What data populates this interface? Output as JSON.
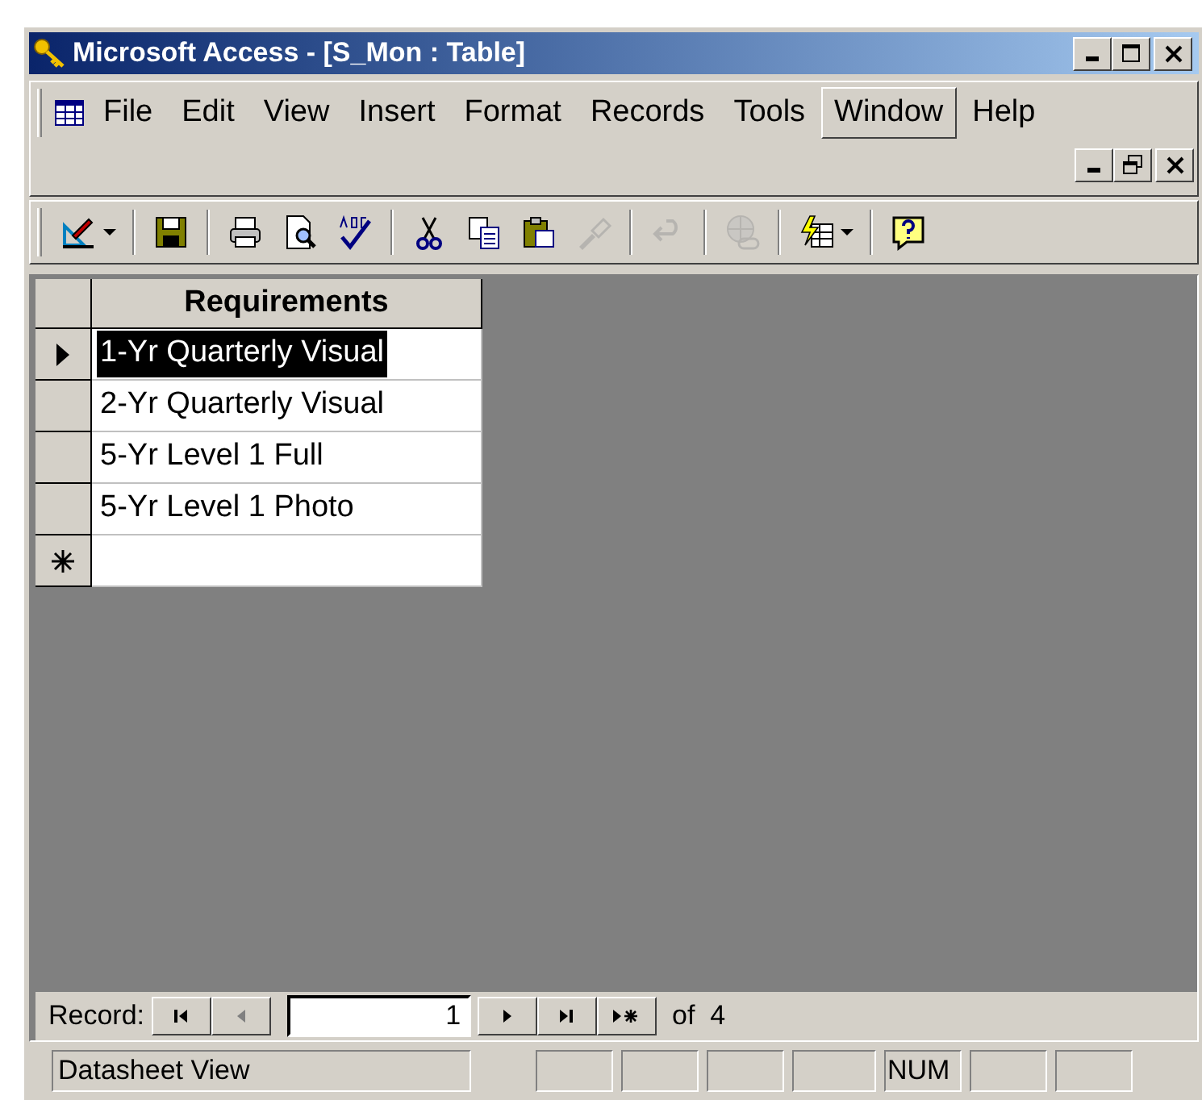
{
  "window": {
    "title": "Microsoft Access - [S_Mon : Table]"
  },
  "menu": [
    {
      "label": "File",
      "selected": false
    },
    {
      "label": "Edit",
      "selected": false
    },
    {
      "label": "View",
      "selected": false
    },
    {
      "label": "Insert",
      "selected": false
    },
    {
      "label": "Format",
      "selected": false
    },
    {
      "label": "Records",
      "selected": false
    },
    {
      "label": "Tools",
      "selected": false
    },
    {
      "label": "Window",
      "selected": true
    },
    {
      "label": "Help",
      "selected": false
    }
  ],
  "toolbar": [
    [
      {
        "disabled": false,
        "dropdown": true
      }
    ],
    [
      {
        "disabled": false,
        "dropdown": false
      }
    ],
    [
      {
        "disabled": false,
        "dropdown": false
      },
      {
        "disabled": false,
        "dropdown": false
      },
      {
        "disabled": false,
        "dropdown": false
      }
    ],
    [
      {
        "disabled": false,
        "dropdown": false
      },
      {
        "disabled": false,
        "dropdown": false
      },
      {
        "disabled": false,
        "dropdown": false
      },
      {
        "disabled": true,
        "dropdown": false
      }
    ],
    [
      {
        "disabled": true,
        "dropdown": false
      }
    ],
    [
      {
        "disabled": true,
        "dropdown": false
      }
    ],
    [
      {
        "disabled": false,
        "dropdown": true
      }
    ],
    [
      {
        "disabled": false,
        "dropdown": false
      }
    ]
  ],
  "table": {
    "columns": [
      "Requirements"
    ],
    "rows": [
      {
        "requirements": "1-Yr Quarterly Visual",
        "selected": true
      },
      {
        "requirements": "2-Yr Quarterly Visual",
        "selected": false
      },
      {
        "requirements": "5-Yr Level 1 Full",
        "selected": false
      },
      {
        "requirements": "5-Yr Level 1 Photo",
        "selected": false
      }
    ]
  },
  "navigator": {
    "label": "Record:",
    "record": "1",
    "total": "of  4",
    "buttons": [
      {
        "disabled": false
      },
      {
        "disabled": true
      },
      {
        "disabled": false
      },
      {
        "disabled": false
      },
      {
        "disabled": false
      }
    ]
  },
  "status_bar": {
    "text": "Datasheet View",
    "indicators": [
      {
        "kind": "empty"
      },
      {
        "kind": "empty"
      },
      {
        "kind": "empty"
      },
      {
        "kind": "empty"
      },
      {
        "kind": "text",
        "text": "NUM"
      },
      {
        "kind": "empty"
      },
      {
        "kind": "empty"
      }
    ]
  }
}
